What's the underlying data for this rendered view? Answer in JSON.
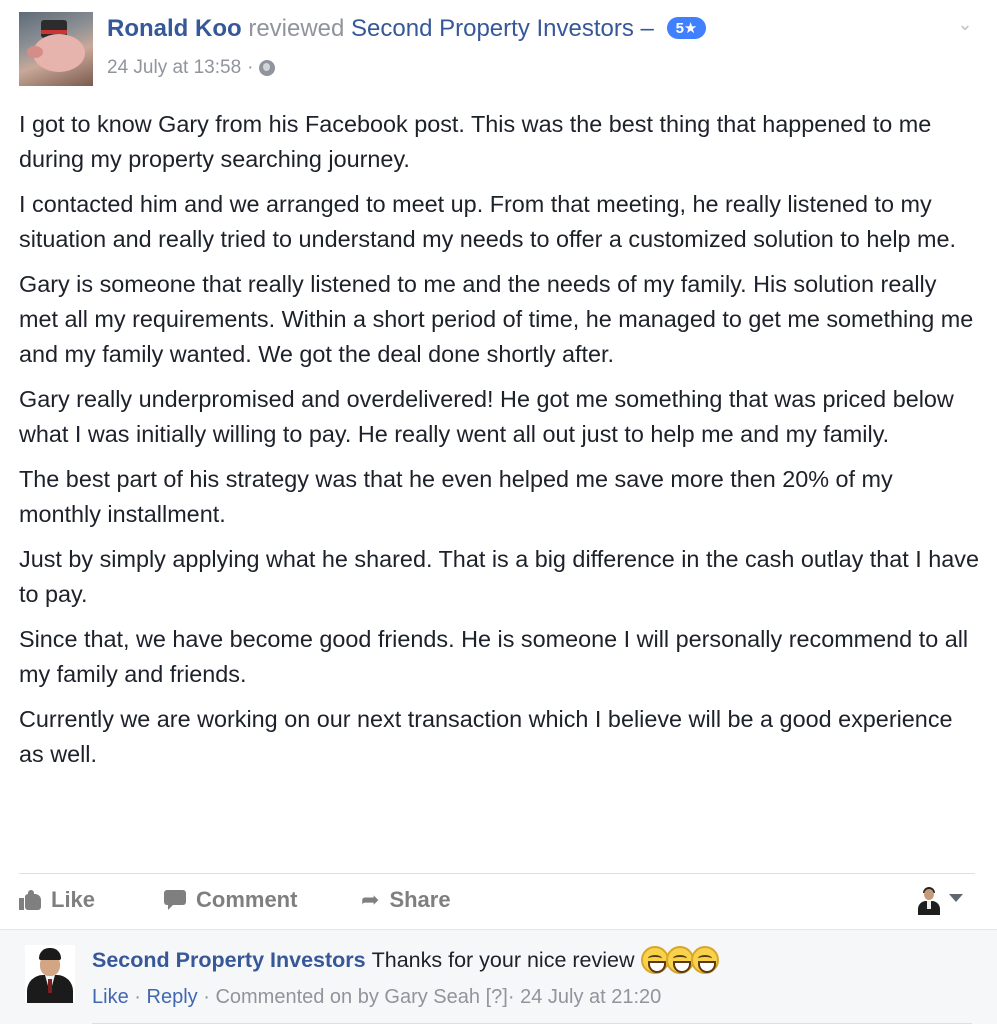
{
  "review": {
    "author": "Ronald Koo",
    "action_word": "reviewed",
    "page": "Second Property Investors",
    "separator": "–",
    "rating_badge": "5★",
    "timestamp": "24 July at 13:58",
    "meta_separator": "·",
    "privacy_icon": "globe-icon",
    "menu_icon": "chevron-down-icon",
    "avatar_icon": "piggy-bank-avatar",
    "paragraphs": [
      "I got to know Gary from his Facebook post. This was the best thing that happened to me during my property searching journey.",
      "I contacted him and we arranged to meet up. From that meeting, he really listened to my situation and really tried to understand my needs to offer a customized solution to help me.",
      "Gary is someone that really listened to me and the needs of my family. His solution really met all my requirements. Within a short period of time, he managed to get me something me and my family wanted. We got the deal done shortly after.",
      "Gary really underpromised and overdelivered! He got me something that was priced below what I was initially willing to pay. He really went all out just to help me and my family.",
      "The best part of his strategy was that he even helped me save more then 20% of my monthly installment.",
      "Just by simply applying what he shared. That is a big difference in the cash outlay that I have to pay.",
      "Since that, we have become good friends. He is someone I will personally recommend to all my family and friends.",
      "Currently we are working on our next transaction which I believe will be a good experience as well."
    ]
  },
  "actions": {
    "like_label": "Like",
    "comment_label": "Comment",
    "share_label": "Share",
    "like_icon": "thumbs-up-icon",
    "comment_icon": "comment-bubble-icon",
    "share_icon": "share-arrow-icon"
  },
  "comment": {
    "author": "Second Property Investors",
    "text": "Thanks for your nice review",
    "emoji": [
      "grin-icon",
      "grin-icon",
      "grin-icon"
    ],
    "like_label": "Like",
    "reply_label": "Reply",
    "dot": "·",
    "commented_on_by": "Commented on by Gary Seah",
    "question": "[?]",
    "timestamp": "24 July at 21:20"
  },
  "colors": {
    "link_blue": "#365899",
    "muted_gray": "#90949c",
    "badge_blue": "#4080ff",
    "action_gray": "#7f7f7f",
    "comment_bg": "#f6f7f9"
  }
}
